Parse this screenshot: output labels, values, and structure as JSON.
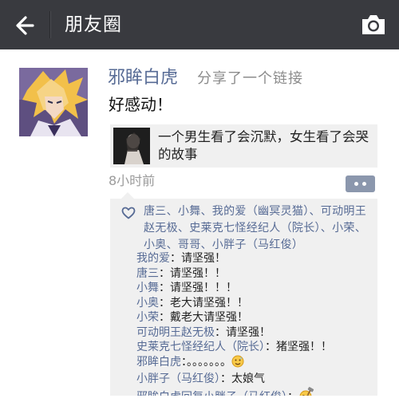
{
  "header": {
    "title": "朋友圈",
    "back_icon": "back-arrow-icon",
    "camera_icon": "camera-icon"
  },
  "post": {
    "author": "邪眸白虎",
    "action": "分享了一个链接",
    "text": "好感动！",
    "link": {
      "title": "一个男生看了会沉默，女生看了会哭的故事"
    },
    "time": "8小时前"
  },
  "likes": {
    "icon": "heart-icon",
    "names": "唐三、小舞、我的爱（幽冥灵猫）、可动明王赵无极、史莱克七怪经纪人（院长）、小荣、小奥、哥哥、小胖子（马红俊）"
  },
  "comments": [
    {
      "name": "我的爱",
      "sep": "：",
      "text": "请坚强！"
    },
    {
      "name": "唐三",
      "sep": "：",
      "text": "请坚强！！"
    },
    {
      "name": "小舞",
      "sep": "：",
      "text": "请坚强！！！"
    },
    {
      "name": "小奥",
      "sep": "：",
      "text": "老大请坚强！！"
    },
    {
      "name": "小荣",
      "sep": "：",
      "text": "戴老大请坚强！"
    },
    {
      "name": "可动明王赵无极",
      "sep": "：",
      "text": "请坚强！"
    },
    {
      "name": "史莱克七怪经纪人（院长）",
      "sep": "：",
      "text": "猪坚强！！"
    },
    {
      "name": "邪眸白虎",
      "sep": "：",
      "text": "。。。。。。。",
      "emoji": "sweat-smile-emoji"
    },
    {
      "name": "小胖子（马红俊）",
      "sep": "：",
      "text": "太娘气"
    },
    {
      "name": "邪眸白虎回复小胖子（马红俊）",
      "sep": "：",
      "text": "",
      "emoji": "angry-hammer-emoji"
    }
  ],
  "colors": {
    "topbar": "#393a3f",
    "name_link": "#576b95",
    "panel": "#f0f0f0"
  }
}
